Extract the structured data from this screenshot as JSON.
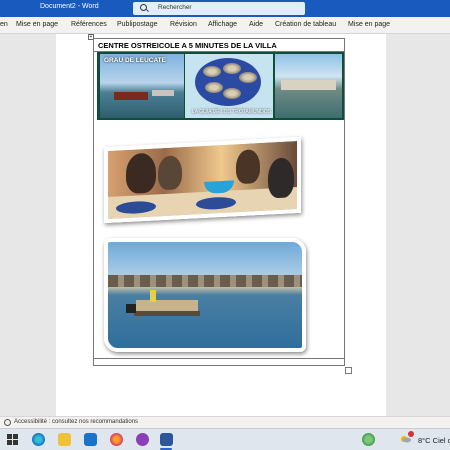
{
  "titlebar": {
    "doc_title": "Document2 - Word",
    "search_label": "Rechercher"
  },
  "ribbon": {
    "tabs": [
      "en",
      "Mise en page",
      "Références",
      "Publipostage",
      "Révision",
      "Affichage",
      "Aide",
      "Création de tableau",
      "Mise en page"
    ]
  },
  "document": {
    "header_text": "CENTRE OSTREICOLE A 5 MINUTES DE LA VILLA",
    "banner_title": "GRAU DE LEUCATE",
    "banner_caption": "LA GUÍA DE LOS TROTAMUNDOS"
  },
  "statusbar": {
    "accessibility_text": "Accessibilité : consultez nos recommandations"
  },
  "taskbar": {
    "weather_text": "8°C  Ciel c",
    "icons": [
      "start-icon",
      "search-icon",
      "edge-icon",
      "file-explorer-icon",
      "mail-icon",
      "firefox-icon",
      "music-icon",
      "word-icon"
    ]
  },
  "colors": {
    "titlebar": "#185abd",
    "ribbon_bg": "#f3f2f1",
    "canvas_bg": "#e7e7e7",
    "taskbar_bg": "#dfe6ee"
  }
}
